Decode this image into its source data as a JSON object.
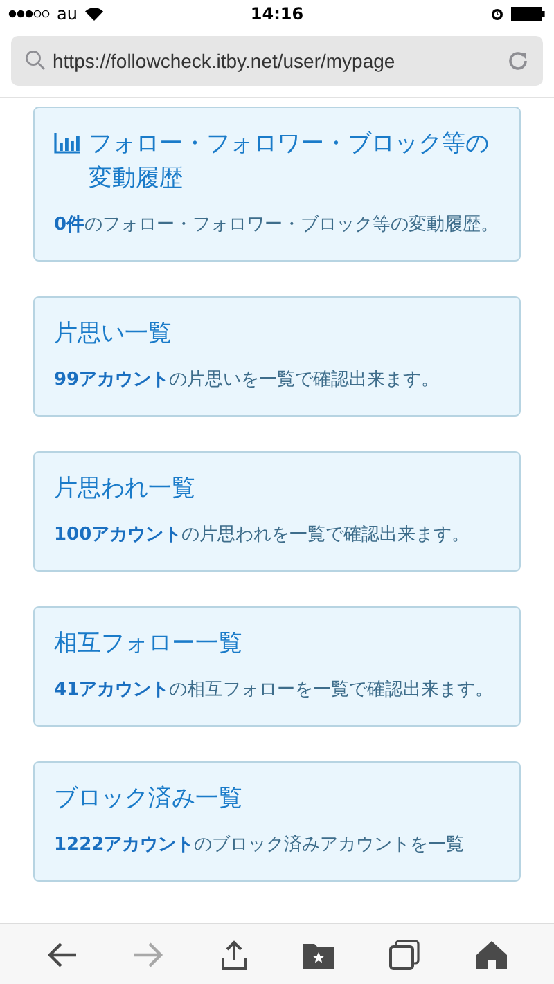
{
  "status_bar": {
    "carrier": "au",
    "time": "14:16"
  },
  "address_bar": {
    "url": "https://followcheck.itby.net/user/mypage"
  },
  "cards": [
    {
      "kind": "chart",
      "title": "フォロー・フォロワー・ブロック等の変動履歴",
      "description": "**0件**のフォロー・フォロワー・ブロック等の変動履歴。"
    },
    {
      "kind": "plain",
      "title": "片思い一覧",
      "description": "**99アカウント**の片思いを一覧で確認出来ます。"
    },
    {
      "kind": "plain",
      "title": "片思われ一覧",
      "description": "**100アカウント**の片思われを一覧で確認出来ます。"
    },
    {
      "kind": "plain",
      "title": "相互フォロー一覧",
      "description": "**41アカウント**の相互フォローを一覧で確認出来ます。"
    },
    {
      "kind": "plain",
      "title": "ブロック済み一覧",
      "description": "**1222アカウント**のブロック済みアカウントを一覧"
    }
  ],
  "toolbar": [
    {
      "kind": "back",
      "disabled": false
    },
    {
      "kind": "forward",
      "disabled": true
    },
    {
      "kind": "share",
      "disabled": false
    },
    {
      "kind": "bookmarks",
      "disabled": false
    },
    {
      "kind": "tabs",
      "disabled": false
    },
    {
      "kind": "home",
      "disabled": false
    }
  ]
}
